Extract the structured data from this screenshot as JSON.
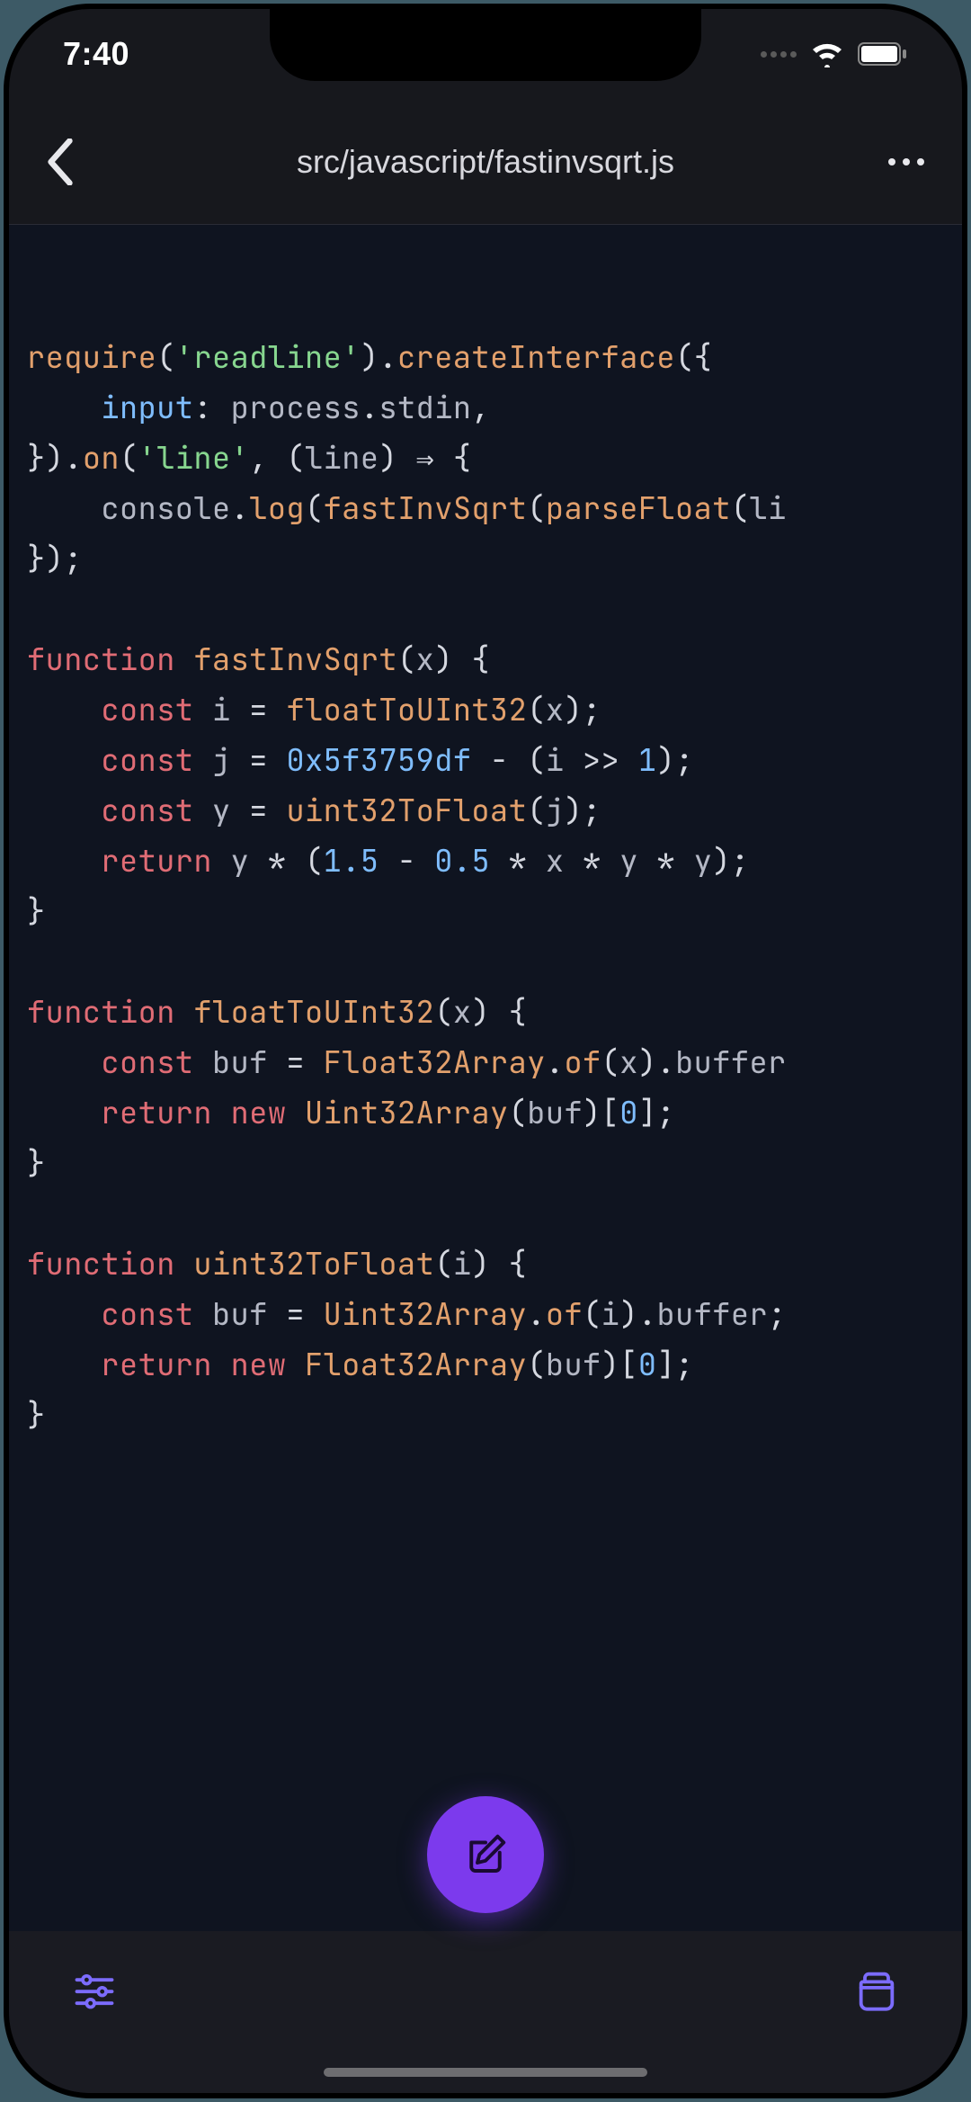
{
  "status": {
    "time": "7:40"
  },
  "nav": {
    "title": "src/javascript/fastinvsqrt.js"
  },
  "colors": {
    "accent": "#7c3aed"
  },
  "code": {
    "lines": [
      [
        {
          "t": "require",
          "c": "tok-fn"
        },
        {
          "t": "(",
          "c": "tok-punc"
        },
        {
          "t": "'readline'",
          "c": "tok-str"
        },
        {
          "t": ").",
          "c": "tok-punc"
        },
        {
          "t": "createInterface",
          "c": "tok-fn"
        },
        {
          "t": "({",
          "c": "tok-punc"
        }
      ],
      [
        {
          "t": "    ",
          "c": ""
        },
        {
          "t": "input",
          "c": "tok-prop"
        },
        {
          "t": ": ",
          "c": "tok-punc"
        },
        {
          "t": "process",
          "c": "tok-id"
        },
        {
          "t": ".",
          "c": "tok-punc"
        },
        {
          "t": "stdin",
          "c": "tok-id"
        },
        {
          "t": ",",
          "c": "tok-punc"
        }
      ],
      [
        {
          "t": "}).",
          "c": "tok-punc"
        },
        {
          "t": "on",
          "c": "tok-fn"
        },
        {
          "t": "(",
          "c": "tok-punc"
        },
        {
          "t": "'line'",
          "c": "tok-str"
        },
        {
          "t": ", (",
          "c": "tok-punc"
        },
        {
          "t": "line",
          "c": "tok-id"
        },
        {
          "t": ") ",
          "c": "tok-punc"
        },
        {
          "t": "⇒",
          "c": "tok-op"
        },
        {
          "t": " {",
          "c": "tok-punc"
        }
      ],
      [
        {
          "t": "    ",
          "c": ""
        },
        {
          "t": "console",
          "c": "tok-id"
        },
        {
          "t": ".",
          "c": "tok-punc"
        },
        {
          "t": "log",
          "c": "tok-fn"
        },
        {
          "t": "(",
          "c": "tok-punc"
        },
        {
          "t": "fastInvSqrt",
          "c": "tok-fn"
        },
        {
          "t": "(",
          "c": "tok-punc"
        },
        {
          "t": "parseFloat",
          "c": "tok-fn"
        },
        {
          "t": "(",
          "c": "tok-punc"
        },
        {
          "t": "li",
          "c": "tok-id"
        }
      ],
      [
        {
          "t": "});",
          "c": "tok-punc"
        }
      ],
      [
        {
          "t": "",
          "c": ""
        }
      ],
      [
        {
          "t": "function",
          "c": "tok-kw"
        },
        {
          "t": " ",
          "c": ""
        },
        {
          "t": "fastInvSqrt",
          "c": "tok-fn"
        },
        {
          "t": "(",
          "c": "tok-punc"
        },
        {
          "t": "x",
          "c": "tok-id"
        },
        {
          "t": ") {",
          "c": "tok-punc"
        }
      ],
      [
        {
          "t": "    ",
          "c": ""
        },
        {
          "t": "const",
          "c": "tok-kw"
        },
        {
          "t": " ",
          "c": ""
        },
        {
          "t": "i",
          "c": "tok-id"
        },
        {
          "t": " = ",
          "c": "tok-op"
        },
        {
          "t": "floatToUInt32",
          "c": "tok-fn"
        },
        {
          "t": "(",
          "c": "tok-punc"
        },
        {
          "t": "x",
          "c": "tok-id"
        },
        {
          "t": ");",
          "c": "tok-punc"
        }
      ],
      [
        {
          "t": "    ",
          "c": ""
        },
        {
          "t": "const",
          "c": "tok-kw"
        },
        {
          "t": " ",
          "c": ""
        },
        {
          "t": "j",
          "c": "tok-id"
        },
        {
          "t": " = ",
          "c": "tok-op"
        },
        {
          "t": "0x5f3759df",
          "c": "tok-num"
        },
        {
          "t": " - (",
          "c": "tok-op"
        },
        {
          "t": "i",
          "c": "tok-id"
        },
        {
          "t": " >> ",
          "c": "tok-op"
        },
        {
          "t": "1",
          "c": "tok-num"
        },
        {
          "t": ");",
          "c": "tok-punc"
        }
      ],
      [
        {
          "t": "    ",
          "c": ""
        },
        {
          "t": "const",
          "c": "tok-kw"
        },
        {
          "t": " ",
          "c": ""
        },
        {
          "t": "y",
          "c": "tok-id"
        },
        {
          "t": " = ",
          "c": "tok-op"
        },
        {
          "t": "uint32ToFloat",
          "c": "tok-fn"
        },
        {
          "t": "(",
          "c": "tok-punc"
        },
        {
          "t": "j",
          "c": "tok-id"
        },
        {
          "t": ");",
          "c": "tok-punc"
        }
      ],
      [
        {
          "t": "    ",
          "c": ""
        },
        {
          "t": "return",
          "c": "tok-kw"
        },
        {
          "t": " ",
          "c": ""
        },
        {
          "t": "y",
          "c": "tok-id"
        },
        {
          "t": " * (",
          "c": "tok-op"
        },
        {
          "t": "1.5",
          "c": "tok-num"
        },
        {
          "t": " - ",
          "c": "tok-op"
        },
        {
          "t": "0.5",
          "c": "tok-num"
        },
        {
          "t": " * ",
          "c": "tok-op"
        },
        {
          "t": "x",
          "c": "tok-id"
        },
        {
          "t": " * ",
          "c": "tok-op"
        },
        {
          "t": "y",
          "c": "tok-id"
        },
        {
          "t": " * ",
          "c": "tok-op"
        },
        {
          "t": "y",
          "c": "tok-id"
        },
        {
          "t": ");",
          "c": "tok-punc"
        }
      ],
      [
        {
          "t": "}",
          "c": "tok-punc"
        }
      ],
      [
        {
          "t": "",
          "c": ""
        }
      ],
      [
        {
          "t": "function",
          "c": "tok-kw"
        },
        {
          "t": " ",
          "c": ""
        },
        {
          "t": "floatToUInt32",
          "c": "tok-fn"
        },
        {
          "t": "(",
          "c": "tok-punc"
        },
        {
          "t": "x",
          "c": "tok-id"
        },
        {
          "t": ") {",
          "c": "tok-punc"
        }
      ],
      [
        {
          "t": "    ",
          "c": ""
        },
        {
          "t": "const",
          "c": "tok-kw"
        },
        {
          "t": " ",
          "c": ""
        },
        {
          "t": "buf",
          "c": "tok-id"
        },
        {
          "t": " = ",
          "c": "tok-op"
        },
        {
          "t": "Float32Array",
          "c": "tok-fn"
        },
        {
          "t": ".",
          "c": "tok-punc"
        },
        {
          "t": "of",
          "c": "tok-fn"
        },
        {
          "t": "(",
          "c": "tok-punc"
        },
        {
          "t": "x",
          "c": "tok-id"
        },
        {
          "t": ").",
          "c": "tok-punc"
        },
        {
          "t": "buffer",
          "c": "tok-id"
        }
      ],
      [
        {
          "t": "    ",
          "c": ""
        },
        {
          "t": "return",
          "c": "tok-kw"
        },
        {
          "t": " ",
          "c": ""
        },
        {
          "t": "new",
          "c": "tok-kw2"
        },
        {
          "t": " ",
          "c": ""
        },
        {
          "t": "Uint32Array",
          "c": "tok-fn"
        },
        {
          "t": "(",
          "c": "tok-punc"
        },
        {
          "t": "buf",
          "c": "tok-id"
        },
        {
          "t": ")[",
          "c": "tok-punc"
        },
        {
          "t": "0",
          "c": "tok-num"
        },
        {
          "t": "];",
          "c": "tok-punc"
        }
      ],
      [
        {
          "t": "}",
          "c": "tok-punc"
        }
      ],
      [
        {
          "t": "",
          "c": ""
        }
      ],
      [
        {
          "t": "function",
          "c": "tok-kw"
        },
        {
          "t": " ",
          "c": ""
        },
        {
          "t": "uint32ToFloat",
          "c": "tok-fn"
        },
        {
          "t": "(",
          "c": "tok-punc"
        },
        {
          "t": "i",
          "c": "tok-id"
        },
        {
          "t": ") {",
          "c": "tok-punc"
        }
      ],
      [
        {
          "t": "    ",
          "c": ""
        },
        {
          "t": "const",
          "c": "tok-kw"
        },
        {
          "t": " ",
          "c": ""
        },
        {
          "t": "buf",
          "c": "tok-id"
        },
        {
          "t": " = ",
          "c": "tok-op"
        },
        {
          "t": "Uint32Array",
          "c": "tok-fn"
        },
        {
          "t": ".",
          "c": "tok-punc"
        },
        {
          "t": "of",
          "c": "tok-fn"
        },
        {
          "t": "(",
          "c": "tok-punc"
        },
        {
          "t": "i",
          "c": "tok-id"
        },
        {
          "t": ").",
          "c": "tok-punc"
        },
        {
          "t": "buffer",
          "c": "tok-id"
        },
        {
          "t": ";",
          "c": "tok-punc"
        }
      ],
      [
        {
          "t": "    ",
          "c": ""
        },
        {
          "t": "return",
          "c": "tok-kw"
        },
        {
          "t": " ",
          "c": ""
        },
        {
          "t": "new",
          "c": "tok-kw2"
        },
        {
          "t": " ",
          "c": ""
        },
        {
          "t": "Float32Array",
          "c": "tok-fn"
        },
        {
          "t": "(",
          "c": "tok-punc"
        },
        {
          "t": "buf",
          "c": "tok-id"
        },
        {
          "t": ")[",
          "c": "tok-punc"
        },
        {
          "t": "0",
          "c": "tok-num"
        },
        {
          "t": "];",
          "c": "tok-punc"
        }
      ],
      [
        {
          "t": "}",
          "c": "tok-punc"
        }
      ]
    ]
  }
}
